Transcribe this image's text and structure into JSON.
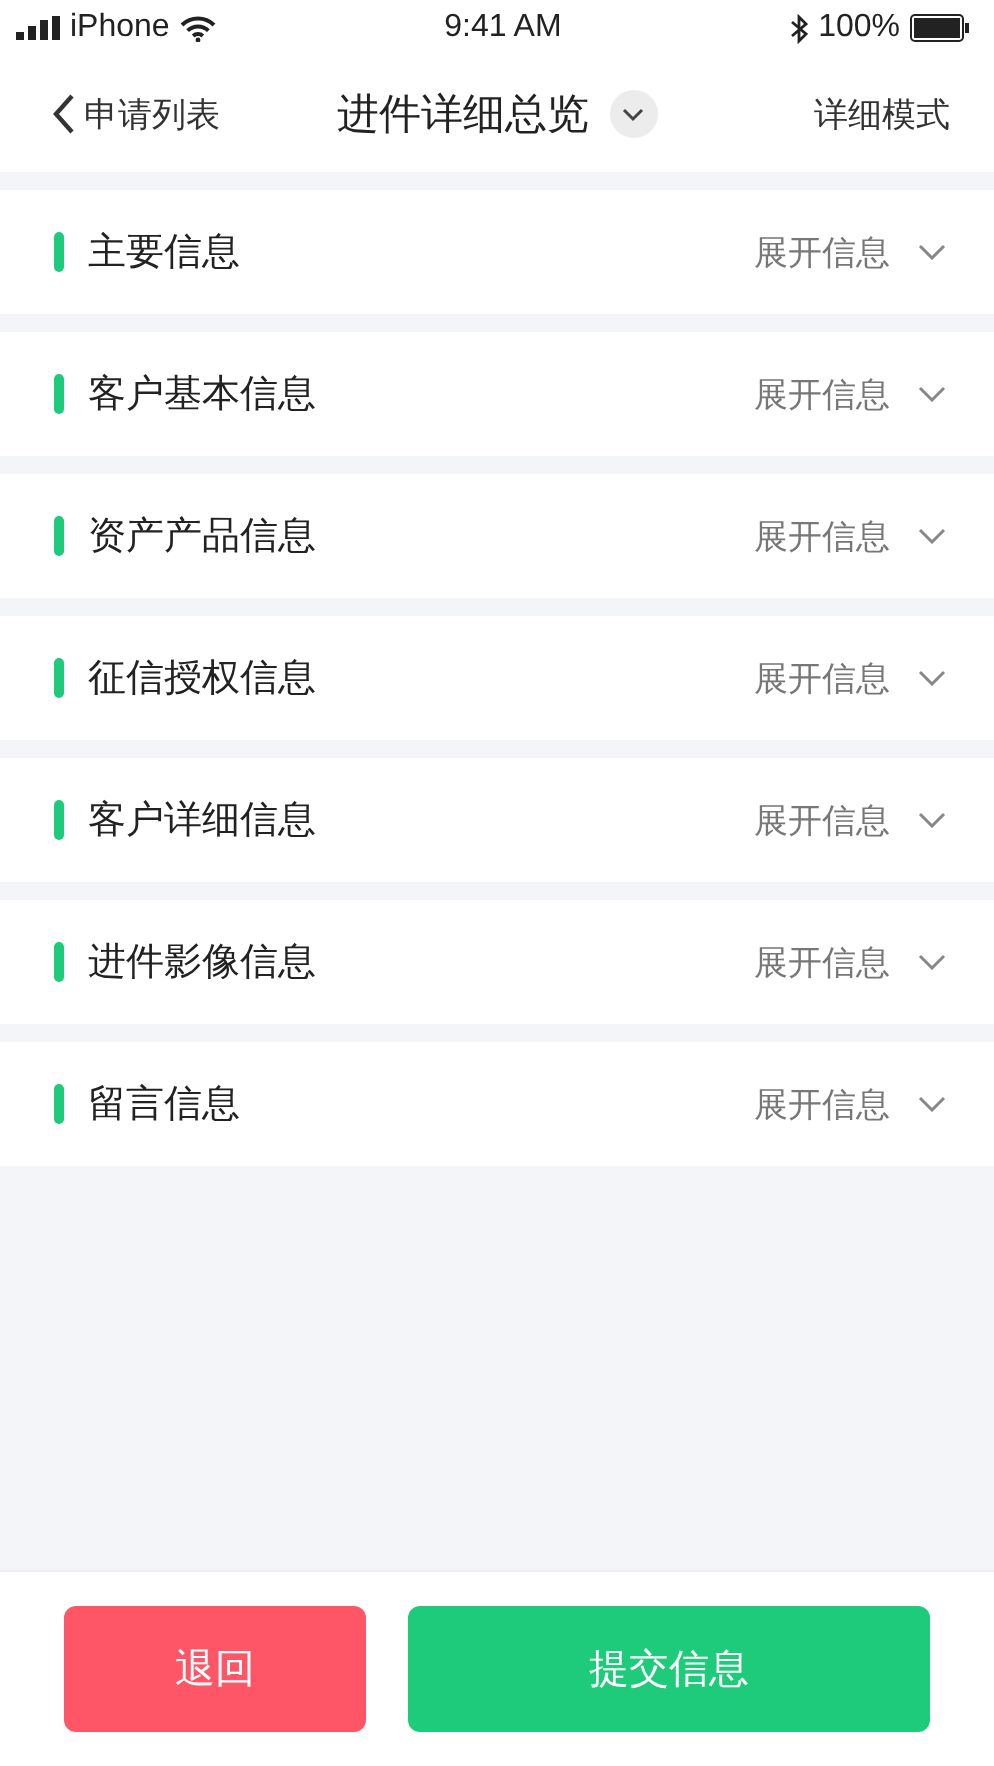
{
  "status_bar": {
    "carrier": "iPhone",
    "time": "9:41 AM",
    "battery": "100%"
  },
  "nav": {
    "back": "申请列表",
    "title": "进件详细总览",
    "action": "详细模式"
  },
  "sections": [
    {
      "title": "主要信息",
      "toggle": "展开信息"
    },
    {
      "title": "客户基本信息",
      "toggle": "展开信息"
    },
    {
      "title": "资产产品信息",
      "toggle": "展开信息"
    },
    {
      "title": "征信授权信息",
      "toggle": "展开信息"
    },
    {
      "title": "客户详细信息",
      "toggle": "展开信息"
    },
    {
      "title": "进件影像信息",
      "toggle": "展开信息"
    },
    {
      "title": "留言信息",
      "toggle": "展开信息"
    }
  ],
  "buttons": [
    {
      "label": "退回",
      "kind": "reject"
    },
    {
      "label": "提交信息",
      "kind": "submit"
    }
  ]
}
